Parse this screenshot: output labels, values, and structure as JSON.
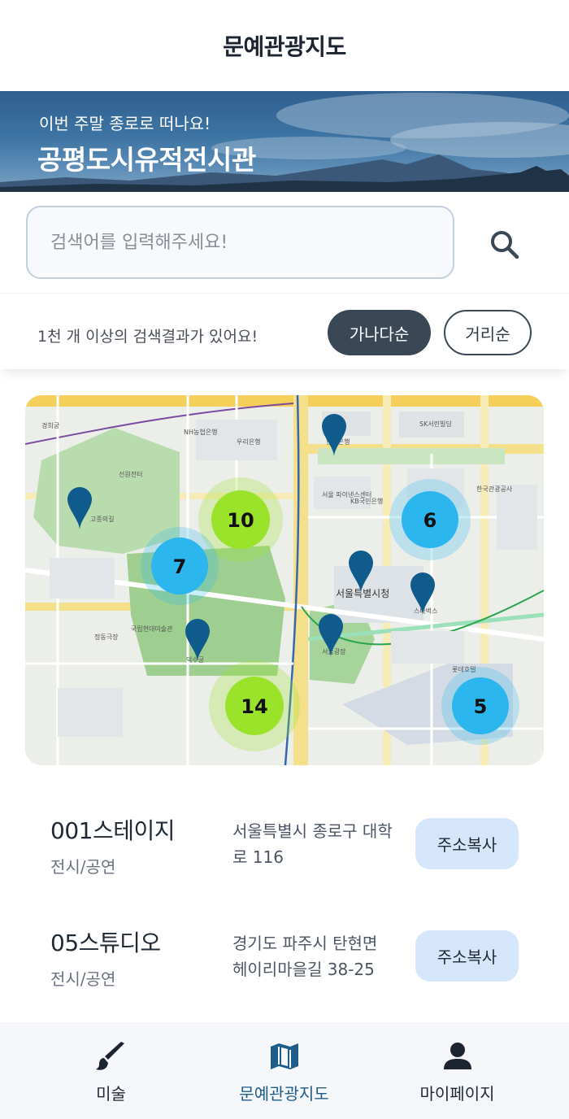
{
  "header": {
    "title": "문예관광지도"
  },
  "banner": {
    "subtitle": "이번 주말 종로로 떠나요!",
    "title": "공평도시유적전시관"
  },
  "search": {
    "placeholder": "검색어를 입력해주세요!"
  },
  "results": {
    "summary": "1천 개 이상의 검색결과가 있어요!",
    "sort_options": [
      "가나다순",
      "거리순"
    ],
    "selected_sort": "가나다순"
  },
  "map": {
    "clusters": [
      {
        "count": "10",
        "color": "#9be22a"
      },
      {
        "count": "6",
        "color": "#2bb6ee"
      },
      {
        "count": "7",
        "color": "#2bb6ee"
      },
      {
        "count": "14",
        "color": "#9be22a"
      },
      {
        "count": "5",
        "color": "#2bb6ee"
      }
    ],
    "labels": {
      "city_hall": "서울특별시청",
      "l1": "NH농협은행",
      "l2": "우리은행",
      "l3": "서울 파이낸스센터",
      "l4": "KB국민은행",
      "l5": "한국관광공사",
      "l6": "SK서린빌딩",
      "l7": "선원전터",
      "l8": "고종의길",
      "l9": "국립현대미술관",
      "l10": "덕수궁",
      "l11": "정동극장",
      "l12": "롯데호텔",
      "l13": "스타벅스",
      "l14": "서울광장",
      "l15": "한국은행",
      "l16": "경희궁"
    },
    "marker_color": "#0f5b8c"
  },
  "places": [
    {
      "name": "001스테이지",
      "category": "전시/공연",
      "address": "서울특별시 종로구 대학로 116",
      "copy_label": "주소복사"
    },
    {
      "name": "05스튜디오",
      "category": "전시/공연",
      "address": "경기도 파주시 탄현면 헤이리마을길 38-25",
      "copy_label": "주소복사"
    }
  ],
  "tabbar": {
    "tabs": [
      {
        "label": "미술",
        "icon": "paintbrush-icon"
      },
      {
        "label": "문예관광지도",
        "icon": "map-icon"
      },
      {
        "label": "마이페이지",
        "icon": "person-icon"
      }
    ],
    "active": "문예관광지도",
    "active_color": "#1e5d8c"
  }
}
